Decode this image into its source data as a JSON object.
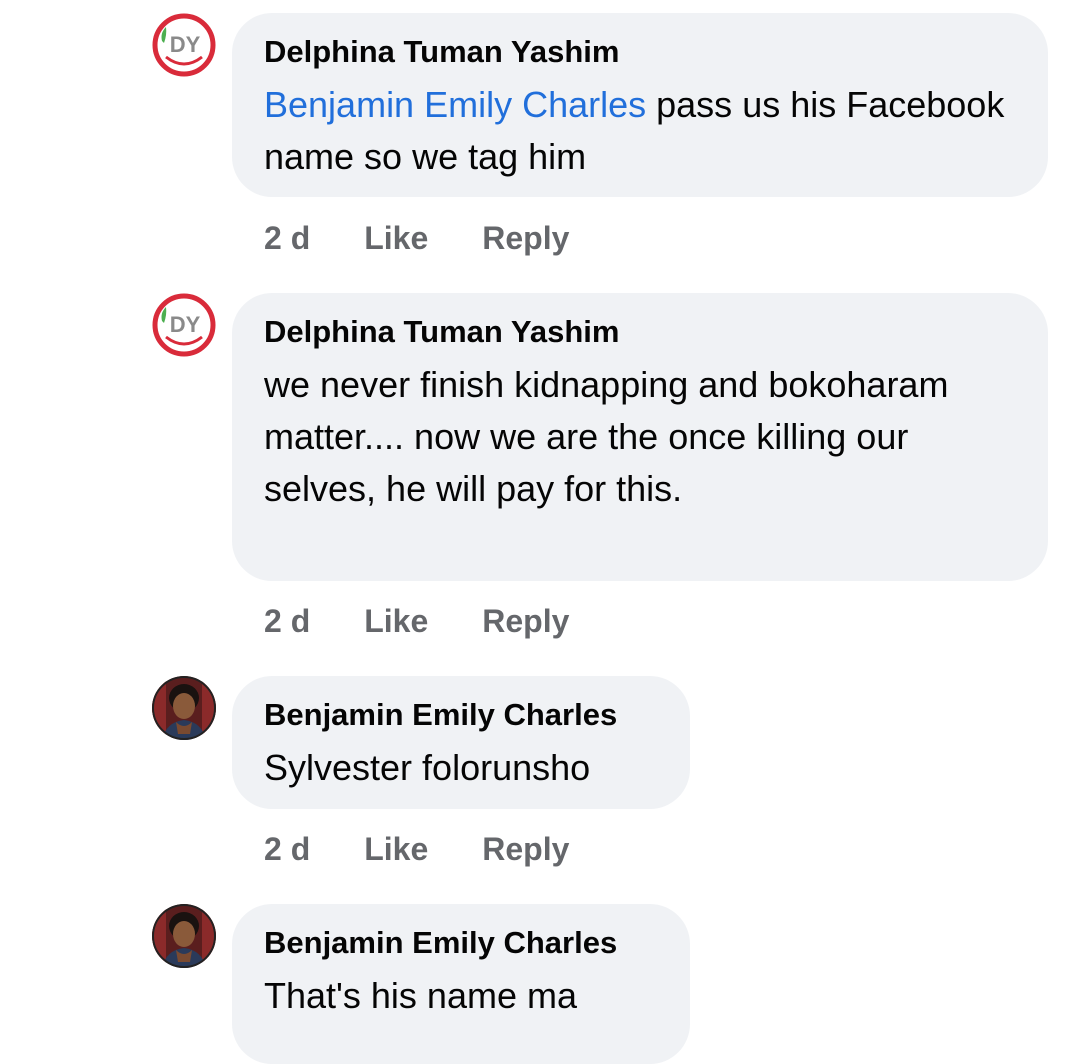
{
  "comments": [
    {
      "author": "Delphina Tuman Yashim",
      "mention": "Benjamin Emily Charles",
      "text": " pass us his Facebook name so we tag him",
      "time": "2 d",
      "like": "Like",
      "reply": "Reply",
      "avatar_icon": "dy-logo-avatar"
    },
    {
      "author": "Delphina Tuman Yashim",
      "mention": "",
      "text": "we never finish kidnapping and bokoharam matter.... now we are the once killing our selves, he will pay for this.",
      "time": "2 d",
      "like": "Like",
      "reply": "Reply",
      "avatar_icon": "dy-logo-avatar"
    },
    {
      "author": "Benjamin Emily Charles",
      "mention": "",
      "text": "Sylvester folorunsho",
      "time": "2 d",
      "like": "Like",
      "reply": "Reply",
      "avatar_icon": "profile-photo-avatar"
    },
    {
      "author": "Benjamin Emily Charles",
      "mention": "",
      "text": "That's his name ma",
      "avatar_icon": "profile-photo-avatar"
    }
  ],
  "colors": {
    "bubble": "#f0f2f5",
    "mention": "#216fdb",
    "meta": "#65676b",
    "logo_red": "#d92b3a",
    "logo_green": "#4caf50"
  }
}
